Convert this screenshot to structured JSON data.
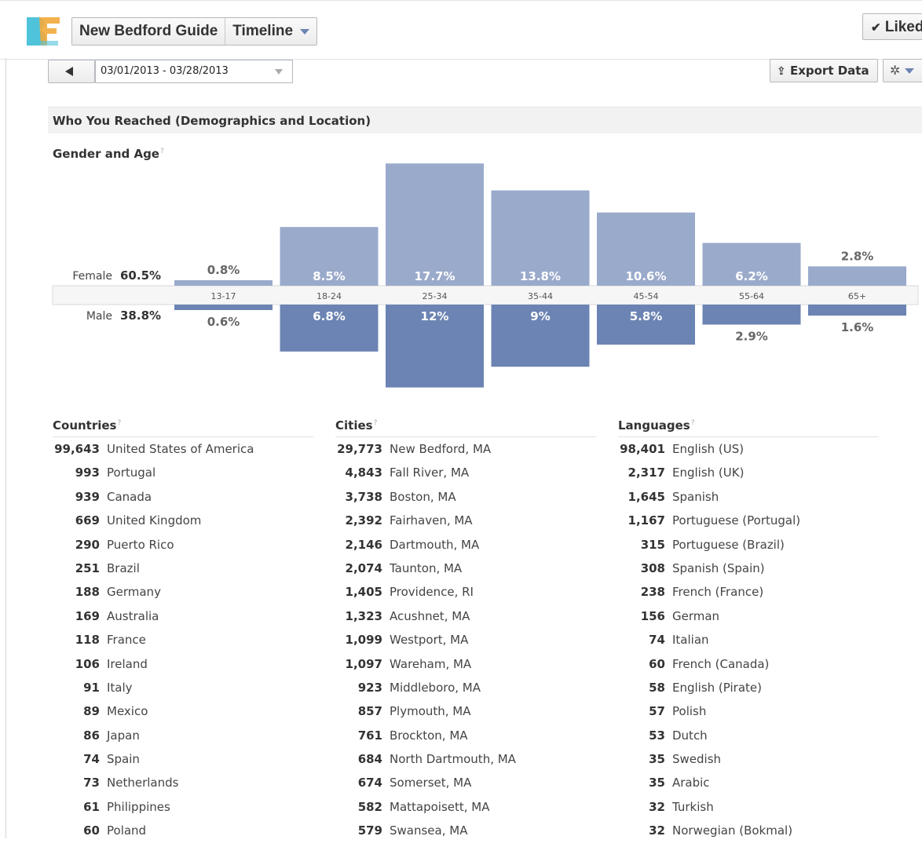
{
  "header": {
    "page_name": "New Bedford Guide",
    "view_label": "Timeline",
    "liked_label": "Liked"
  },
  "toolbar": {
    "date_range": "03/01/2013 - 03/28/2013",
    "export_label": "Export Data"
  },
  "section": {
    "title": "Who You Reached (Demographics and Location)",
    "gender_age_title": "Gender and Age",
    "help_mark": "?"
  },
  "chart_data": {
    "type": "bar",
    "categories": [
      "13-17",
      "18-24",
      "25-34",
      "35-44",
      "45-54",
      "55-64",
      "65+"
    ],
    "series": [
      {
        "name": "Female",
        "values": [
          0.8,
          8.5,
          17.7,
          13.8,
          10.6,
          6.2,
          2.8
        ],
        "labels": [
          "0.8%",
          "8.5%",
          "17.7%",
          "13.8%",
          "10.6%",
          "6.2%",
          "2.8%"
        ],
        "total_label": "60.5%"
      },
      {
        "name": "Male",
        "values": [
          0.6,
          6.8,
          12,
          9,
          5.8,
          2.9,
          1.6
        ],
        "labels": [
          "0.6%",
          "6.8%",
          "12%",
          "9%",
          "5.8%",
          "2.9%",
          "1.6%"
        ],
        "total_label": "38.8%"
      }
    ],
    "colors": {
      "female": "#9aaacb",
      "male": "#6c84b3"
    }
  },
  "countries": {
    "title": "Countries",
    "items": [
      {
        "count": "99,643",
        "name": "United States of America"
      },
      {
        "count": "993",
        "name": "Portugal"
      },
      {
        "count": "939",
        "name": "Canada"
      },
      {
        "count": "669",
        "name": "United Kingdom"
      },
      {
        "count": "290",
        "name": "Puerto Rico"
      },
      {
        "count": "251",
        "name": "Brazil"
      },
      {
        "count": "188",
        "name": "Germany"
      },
      {
        "count": "169",
        "name": "Australia"
      },
      {
        "count": "118",
        "name": "France"
      },
      {
        "count": "106",
        "name": "Ireland"
      },
      {
        "count": "91",
        "name": "Italy"
      },
      {
        "count": "89",
        "name": "Mexico"
      },
      {
        "count": "86",
        "name": "Japan"
      },
      {
        "count": "74",
        "name": "Spain"
      },
      {
        "count": "73",
        "name": "Netherlands"
      },
      {
        "count": "61",
        "name": "Philippines"
      },
      {
        "count": "60",
        "name": "Poland"
      }
    ]
  },
  "cities": {
    "title": "Cities",
    "items": [
      {
        "count": "29,773",
        "name": "New Bedford, MA"
      },
      {
        "count": "4,843",
        "name": "Fall River, MA"
      },
      {
        "count": "3,738",
        "name": "Boston, MA"
      },
      {
        "count": "2,392",
        "name": "Fairhaven, MA"
      },
      {
        "count": "2,146",
        "name": "Dartmouth, MA"
      },
      {
        "count": "2,074",
        "name": "Taunton, MA"
      },
      {
        "count": "1,405",
        "name": "Providence, RI"
      },
      {
        "count": "1,323",
        "name": "Acushnet, MA"
      },
      {
        "count": "1,099",
        "name": "Westport, MA"
      },
      {
        "count": "1,097",
        "name": "Wareham, MA"
      },
      {
        "count": "923",
        "name": "Middleboro, MA"
      },
      {
        "count": "857",
        "name": "Plymouth, MA"
      },
      {
        "count": "761",
        "name": "Brockton, MA"
      },
      {
        "count": "684",
        "name": "North Dartmouth, MA"
      },
      {
        "count": "674",
        "name": "Somerset, MA"
      },
      {
        "count": "582",
        "name": "Mattapoisett, MA"
      },
      {
        "count": "579",
        "name": "Swansea, MA"
      }
    ]
  },
  "languages": {
    "title": "Languages",
    "items": [
      {
        "count": "98,401",
        "name": "English (US)"
      },
      {
        "count": "2,317",
        "name": "English (UK)"
      },
      {
        "count": "1,645",
        "name": "Spanish"
      },
      {
        "count": "1,167",
        "name": "Portuguese (Portugal)"
      },
      {
        "count": "315",
        "name": "Portuguese (Brazil)"
      },
      {
        "count": "308",
        "name": "Spanish (Spain)"
      },
      {
        "count": "238",
        "name": "French (France)"
      },
      {
        "count": "156",
        "name": "German"
      },
      {
        "count": "74",
        "name": "Italian"
      },
      {
        "count": "60",
        "name": "French (Canada)"
      },
      {
        "count": "58",
        "name": "English (Pirate)"
      },
      {
        "count": "57",
        "name": "Polish"
      },
      {
        "count": "53",
        "name": "Dutch"
      },
      {
        "count": "35",
        "name": "Swedish"
      },
      {
        "count": "35",
        "name": "Arabic"
      },
      {
        "count": "32",
        "name": "Turkish"
      },
      {
        "count": "32",
        "name": "Norwegian (Bokmal)"
      }
    ]
  }
}
